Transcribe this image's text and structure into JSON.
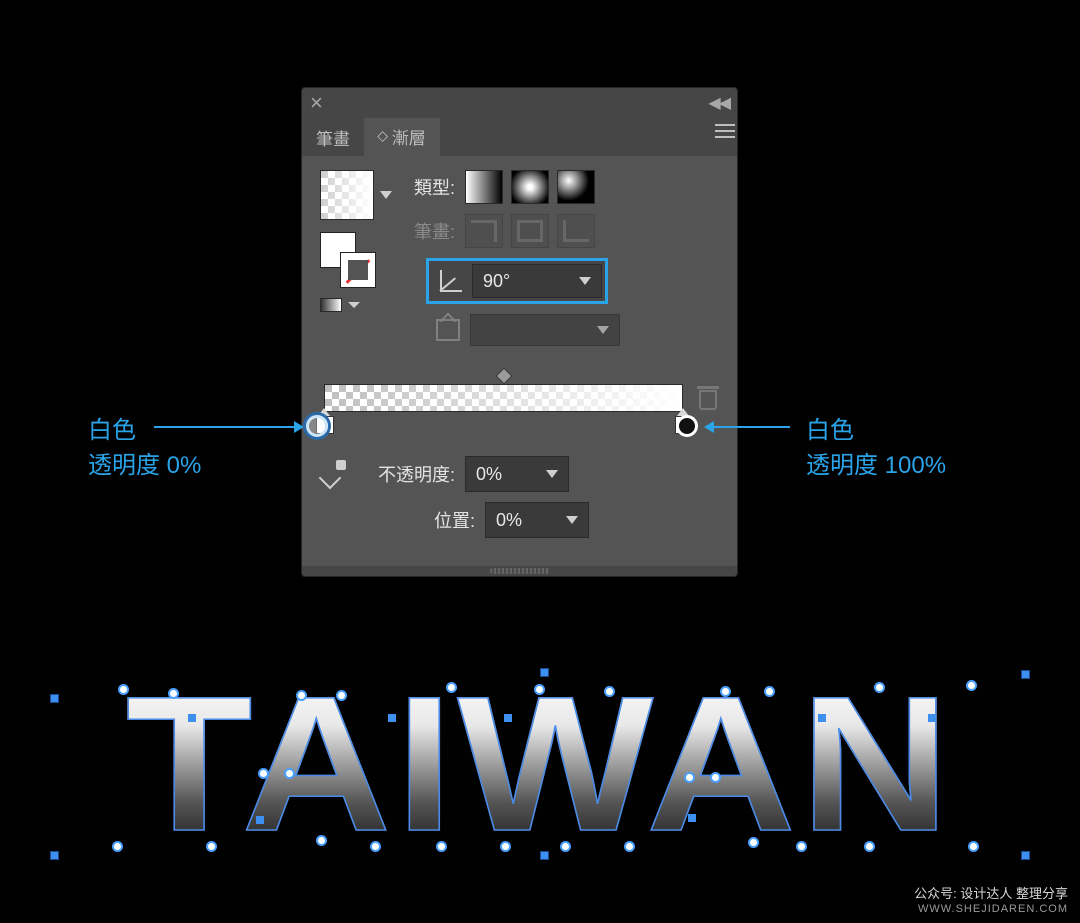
{
  "panel": {
    "tabs": {
      "stroke": "筆畫",
      "gradient": "漸層"
    },
    "type_label": "類型:",
    "stroke_label": "筆畫:",
    "angle_value": "90°",
    "aspect_value": "",
    "opacity_label": "不透明度:",
    "opacity_value": "0%",
    "location_label": "位置:",
    "location_value": "0%"
  },
  "callouts": {
    "left_line1": "白色",
    "left_line2": "透明度 0%",
    "right_line1": "白色",
    "right_line2": "透明度 100%"
  },
  "artwork_text": "TAIWAN",
  "watermark": {
    "line1": "公众号: 设计达人 整理分享",
    "line2": "WWW.SHEJIDAREN.COM"
  }
}
